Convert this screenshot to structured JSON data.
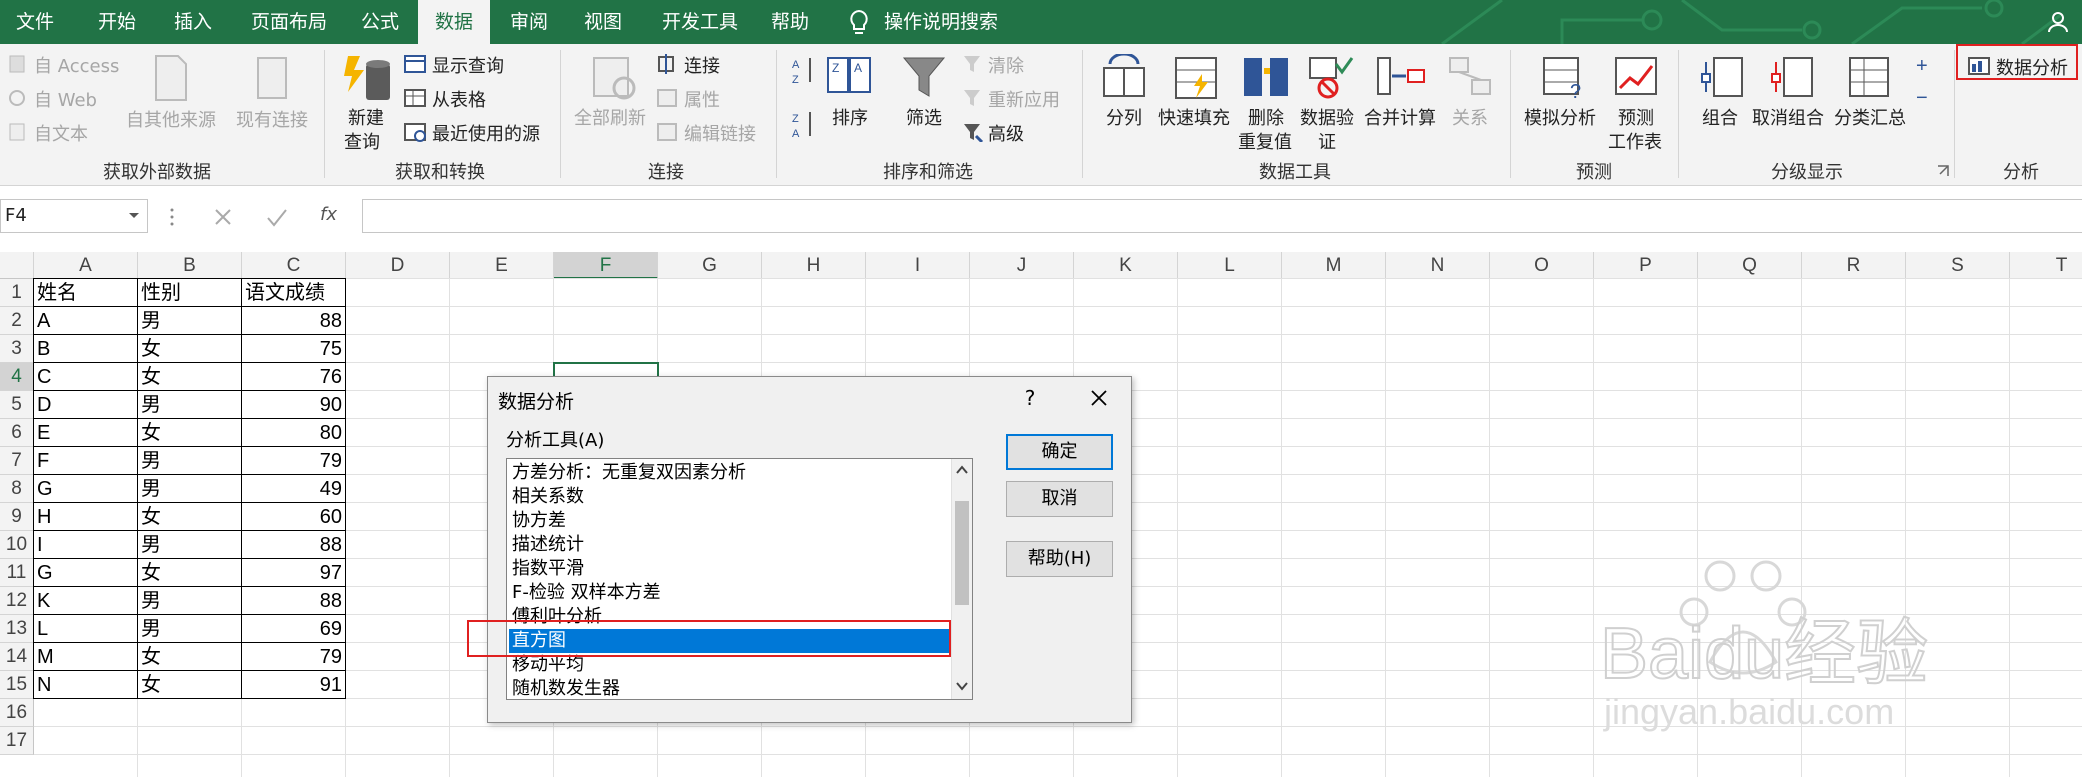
{
  "menu": {
    "tabs": [
      "文件",
      "开始",
      "插入",
      "页面布局",
      "公式",
      "数据",
      "审阅",
      "视图",
      "开发工具",
      "帮助"
    ],
    "active": "数据",
    "tell_me": "操作说明搜索"
  },
  "ribbon": {
    "external": {
      "access": "自 Access",
      "web": "自 Web",
      "text": "自文本",
      "other": "自其他来源",
      "existing": "现有连接",
      "label": "获取外部数据"
    },
    "transform": {
      "new_query_1": "新建",
      "new_query_2": "查询",
      "show_query": "显示查询",
      "from_table": "从表格",
      "recent": "最近使用的源",
      "label": "获取和转换"
    },
    "connections": {
      "refresh_all": "全部刷新",
      "connections": "连接",
      "properties": "属性",
      "edit_links": "编辑链接",
      "label": "连接"
    },
    "sort_filter": {
      "sort": "排序",
      "filter": "筛选",
      "clear": "清除",
      "reapply": "重新应用",
      "advanced": "高级",
      "label": "排序和筛选"
    },
    "data_tools": {
      "split": "分列",
      "flash_fill": "快速填充",
      "remove_dup_1": "删除",
      "remove_dup_2": "重复值",
      "validation_1": "数据验",
      "validation_2": "证",
      "consolidate": "合并计算",
      "relationships": "关系",
      "label": "数据工具"
    },
    "forecast": {
      "what_if": "模拟分析",
      "sheet_1": "预测",
      "sheet_2": "工作表",
      "label": "预测"
    },
    "outline": {
      "group": "组合",
      "ungroup": "取消组合",
      "subtotal": "分类汇总",
      "label": "分级显示"
    },
    "analysis": {
      "data_analysis": "数据分析",
      "label": "分析"
    }
  },
  "formula_bar": {
    "name_box": "F4",
    "fx": "fx"
  },
  "sheet": {
    "columns": [
      "A",
      "B",
      "C",
      "D",
      "E",
      "F",
      "G",
      "H",
      "I",
      "J",
      "K",
      "L",
      "M",
      "N",
      "O",
      "P",
      "Q",
      "R",
      "S",
      "T"
    ],
    "rows": [
      "1",
      "2",
      "3",
      "4",
      "5",
      "6",
      "7",
      "8",
      "9",
      "10",
      "11",
      "12",
      "13",
      "14",
      "15",
      "16",
      "17"
    ],
    "header": [
      "姓名",
      "性别",
      "语文成绩"
    ],
    "data": [
      [
        "A",
        "男",
        "88"
      ],
      [
        "B",
        "女",
        "75"
      ],
      [
        "C",
        "女",
        "76"
      ],
      [
        "D",
        "男",
        "90"
      ],
      [
        "E",
        "女",
        "80"
      ],
      [
        "F",
        "男",
        "79"
      ],
      [
        "G",
        "男",
        "49"
      ],
      [
        "H",
        "女",
        "60"
      ],
      [
        "I",
        "男",
        "88"
      ],
      [
        "G",
        "女",
        "97"
      ],
      [
        "K",
        "男",
        "88"
      ],
      [
        "L",
        "男",
        "69"
      ],
      [
        "M",
        "女",
        "79"
      ],
      [
        "N",
        "女",
        "91"
      ]
    ]
  },
  "dialog": {
    "title": "数据分析",
    "help": "?",
    "tools_label": "分析工具(A)",
    "items": [
      "方差分析：无重复双因素分析",
      "相关系数",
      "协方差",
      "描述统计",
      "指数平滑",
      "F-检验 双样本方差",
      "傅利叶分析",
      "直方图",
      "移动平均",
      "随机数发生器"
    ],
    "selected": "直方图",
    "ok": "确定",
    "cancel": "取消",
    "help_button": "帮助(H)"
  },
  "watermark": {
    "brand": "Baidu经验",
    "url": "jingyan.baidu.com"
  },
  "colors": {
    "excel_green": "#217346",
    "selection_blue": "#0078d7",
    "highlight_red": "#e02020"
  }
}
